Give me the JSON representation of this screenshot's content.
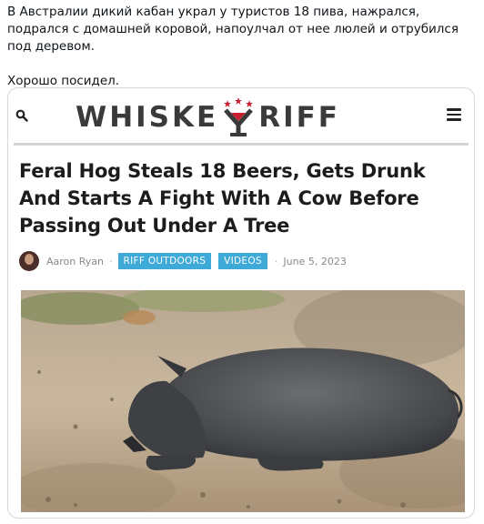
{
  "post": {
    "line1": "В Австралии дикий кабан украл у туристов 18 пива, нажрался, подрался с домашней коровой, напоулчал от нее люлей и отрубился под деревом.",
    "line2": "Хорошо посидел."
  },
  "card": {
    "logo_left": "WHISKE",
    "logo_right": "RIFF",
    "headline": "Feral Hog Steals 18 Beers, Gets Drunk And Starts A Fight With A Cow Before Passing Out Under A Tree",
    "author": "Aaron Ryan",
    "separator": "·",
    "tags": [
      "RIFF OUTDOORS",
      "VIDEOS"
    ],
    "date": "June 5, 2023",
    "icons": {
      "search": "search-icon",
      "menu": "hamburger-menu-icon",
      "logo_mark": "whiskey-glass-y-icon",
      "avatar": "author-avatar"
    },
    "colors": {
      "tag_bg": "#3fa9d8",
      "logo_text": "#3a3a3a",
      "logo_red": "#c8202f",
      "logo_blue": "#1f3a73"
    }
  }
}
